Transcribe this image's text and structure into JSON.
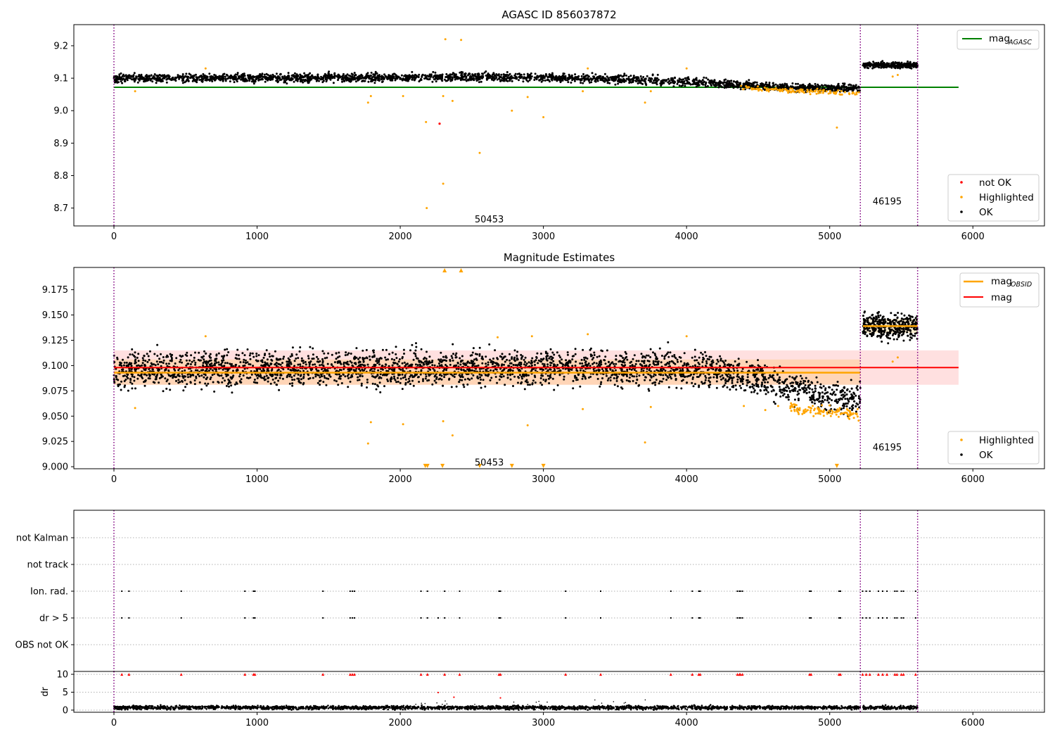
{
  "chart_data": [
    {
      "type": "scatter",
      "title": "AGASC ID 856037872",
      "xlim": [
        -280,
        6500
      ],
      "ylim": [
        8.645,
        9.265
      ],
      "xticks": [
        "0",
        "1000",
        "2000",
        "3000",
        "4000",
        "5000",
        "6000"
      ],
      "yticks": [
        "8.7",
        "8.8",
        "8.9",
        "9.0",
        "9.1",
        "9.2"
      ],
      "legend_top": {
        "position": "top-right",
        "entries": [
          "mag",
          "AGASC"
        ]
      },
      "legend_bottom": {
        "position": "bottom-right",
        "entries": [
          "not OK",
          "Highlighted",
          "OK"
        ]
      },
      "reference_line": {
        "name": "mag_AGASC",
        "y": 9.072,
        "x_range": [
          0,
          5900
        ],
        "color": "#008000"
      },
      "obsid_boundaries": [
        0,
        5214,
        5614
      ],
      "obsid_labels": [
        {
          "text": "50453",
          "x": 2520,
          "y": 8.665
        },
        {
          "text": "46195",
          "x": 5300,
          "y": 8.72
        }
      ],
      "series": [
        {
          "name": "OK",
          "color": "#000000",
          "segments": [
            {
              "x_range": [
                0,
                5214
              ],
              "level": [
                9.1,
                9.1,
                9.103,
                9.103,
                9.09,
                9.072,
                9.068
              ],
              "level_x": [
                0,
                1000,
                2000,
                3000,
                4000,
                4700,
                5214
              ],
              "spread": 0.009,
              "count": 2500
            },
            {
              "x_range": [
                5232,
                5614
              ],
              "level": [
                9.14,
                9.14
              ],
              "level_x": [
                5232,
                5614
              ],
              "spread": 0.006,
              "count": 320
            }
          ]
        },
        {
          "name": "Highlighted",
          "color": "#ffa500",
          "points": [
            [
              148,
              9.06
            ],
            [
              640,
              9.13
            ],
            [
              1775,
              9.025
            ],
            [
              1795,
              9.045
            ],
            [
              2020,
              9.045
            ],
            [
              2180,
              8.965
            ],
            [
              2185,
              8.7
            ],
            [
              2300,
              9.045
            ],
            [
              2300,
              8.775
            ],
            [
              2315,
              9.22
            ],
            [
              2365,
              9.03
            ],
            [
              2425,
              9.218
            ],
            [
              2555,
              8.87
            ],
            [
              2780,
              9.0
            ],
            [
              2890,
              9.042
            ],
            [
              3000,
              8.98
            ],
            [
              3275,
              9.06
            ],
            [
              3310,
              9.13
            ],
            [
              3710,
              9.025
            ],
            [
              3750,
              9.06
            ],
            [
              4000,
              9.13
            ],
            [
              5050,
              8.948
            ],
            [
              5440,
              9.105
            ],
            [
              5475,
              9.11
            ]
          ],
          "band_x_range": [
            4350,
            5214
          ],
          "band_count": 120
        },
        {
          "name": "not OK",
          "color": "#ff0000",
          "points": [
            [
              2275,
              8.96
            ]
          ]
        }
      ]
    },
    {
      "type": "scatter",
      "title": "Magnitude Estimates",
      "xlim": [
        -280,
        6500
      ],
      "ylim": [
        8.998,
        9.197
      ],
      "xticks": [
        "0",
        "1000",
        "2000",
        "3000",
        "4000",
        "5000",
        "6000"
      ],
      "yticks": [
        "9.000",
        "9.025",
        "9.050",
        "9.075",
        "9.100",
        "9.125",
        "9.150",
        "9.175"
      ],
      "legend_top": {
        "position": "top-right",
        "entries": [
          "mag",
          "OBSID",
          "mag"
        ]
      },
      "legend_bottom": {
        "position": "bottom-right",
        "entries": [
          "Highlighted",
          "OK"
        ]
      },
      "mag_line": {
        "y": 9.098,
        "x_range": [
          0,
          5900
        ],
        "band": [
          9.081,
          9.115
        ],
        "color": "#ff0000"
      },
      "obsid_mag": [
        {
          "y": 9.093,
          "x_range": [
            0,
            5214
          ],
          "band": [
            9.081,
            9.106
          ]
        },
        {
          "y": 9.139,
          "x_range": [
            5232,
            5614
          ],
          "band": [
            9.132,
            9.146
          ]
        }
      ],
      "obsid_boundaries": [
        0,
        5214,
        5614
      ],
      "obsid_labels": [
        {
          "text": "50453",
          "x": 2520,
          "y": 9.004
        },
        {
          "text": "46195",
          "x": 5300,
          "y": 9.019
        }
      ],
      "series": [
        {
          "name": "OK",
          "color": "#000000",
          "segments": [
            {
              "x_range": [
                0,
                5214
              ],
              "level": [
                9.095,
                9.097,
                9.098,
                9.098,
                9.097,
                9.09,
                9.08,
                9.068,
                9.066
              ],
              "level_x": [
                0,
                1000,
                2000,
                3000,
                4000,
                4400,
                4700,
                5000,
                5214
              ],
              "spread": 0.012,
              "count": 3000
            },
            {
              "x_range": [
                5232,
                5614
              ],
              "level": [
                9.14,
                9.138
              ],
              "level_x": [
                5232,
                5614
              ],
              "spread": 0.009,
              "count": 380
            }
          ]
        },
        {
          "name": "Highlighted",
          "color": "#ffa500",
          "points": [
            [
              148,
              9.058
            ],
            [
              640,
              9.129
            ],
            [
              1775,
              9.023
            ],
            [
              1795,
              9.044
            ],
            [
              2020,
              9.042
            ],
            [
              2300,
              9.045
            ],
            [
              2365,
              9.031
            ],
            [
              2680,
              9.128
            ],
            [
              2920,
              9.129
            ],
            [
              2890,
              9.041
            ],
            [
              3275,
              9.057
            ],
            [
              3310,
              9.131
            ],
            [
              3710,
              9.024
            ],
            [
              3750,
              9.059
            ],
            [
              4000,
              9.129
            ],
            [
              4400,
              9.06
            ],
            [
              4550,
              9.056
            ],
            [
              4640,
              9.06
            ],
            [
              5440,
              9.104
            ],
            [
              5475,
              9.108
            ]
          ],
          "band_x_range": [
            4720,
            5214
          ],
          "band_count": 110,
          "clipped_low_x": [
            2175,
            2190,
            2295,
            2555,
            2780,
            3000,
            5050
          ],
          "clipped_high_x": [
            2310,
            2425
          ]
        }
      ]
    },
    {
      "type": "scatter",
      "title": "",
      "xlim": [
        -280,
        6500
      ],
      "categories": [
        "not Kalman",
        "not track",
        "Ion. rad.",
        "dr > 5",
        "OBS not OK"
      ],
      "flag_events": {
        "Ion. rad.": [
          55,
          105,
          470,
          915,
          975,
          985,
          1460,
          1650,
          1665,
          1680,
          2145,
          2190,
          2310,
          2415,
          2690,
          2700,
          3155,
          3400,
          3890,
          4040,
          4085,
          4095,
          4355,
          4370,
          4375,
          4390,
          4860,
          4870,
          5065,
          5075,
          5230,
          5255,
          5280,
          5340,
          5370,
          5400,
          5455,
          5470,
          5500,
          5515,
          5600
        ],
        "dr > 5": [
          55,
          105,
          470,
          915,
          975,
          985,
          1460,
          1650,
          1665,
          1680,
          2145,
          2190,
          2265,
          2310,
          2415,
          2690,
          2700,
          3155,
          3400,
          3890,
          4040,
          4085,
          4095,
          4355,
          4370,
          4375,
          4390,
          4860,
          4870,
          5065,
          5075,
          5230,
          5255,
          5280,
          5340,
          5370,
          5400,
          5455,
          5470,
          5500,
          5515,
          5600
        ]
      },
      "obsid_boundaries": [
        0,
        5214,
        5614
      ]
    },
    {
      "type": "scatter",
      "title": "",
      "xlim": [
        -280,
        6500
      ],
      "ylim": [
        -0.6,
        10.8
      ],
      "ylabel": "dr",
      "xticks": [
        "0",
        "1000",
        "2000",
        "3000",
        "4000",
        "5000",
        "6000"
      ],
      "yticks": [
        "0",
        "5",
        "10"
      ],
      "clipped_at": 10,
      "clipped_x": [
        55,
        105,
        470,
        915,
        975,
        985,
        1460,
        1650,
        1665,
        1680,
        2145,
        2190,
        2310,
        2415,
        2690,
        2700,
        3155,
        3400,
        3890,
        4040,
        4085,
        4095,
        4355,
        4370,
        4375,
        4390,
        4860,
        4870,
        5065,
        5075,
        5230,
        5255,
        5280,
        5340,
        5370,
        5400,
        5455,
        5470,
        5500,
        5515,
        5600
      ],
      "outliers": [
        [
          2265,
          4.9
        ],
        [
          2375,
          3.6
        ],
        [
          2700,
          3.4
        ]
      ],
      "baseline": {
        "level": 0.7,
        "spread": 0.35,
        "count": 2600
      },
      "obsid_boundaries": [
        0,
        5214,
        5614
      ]
    }
  ]
}
